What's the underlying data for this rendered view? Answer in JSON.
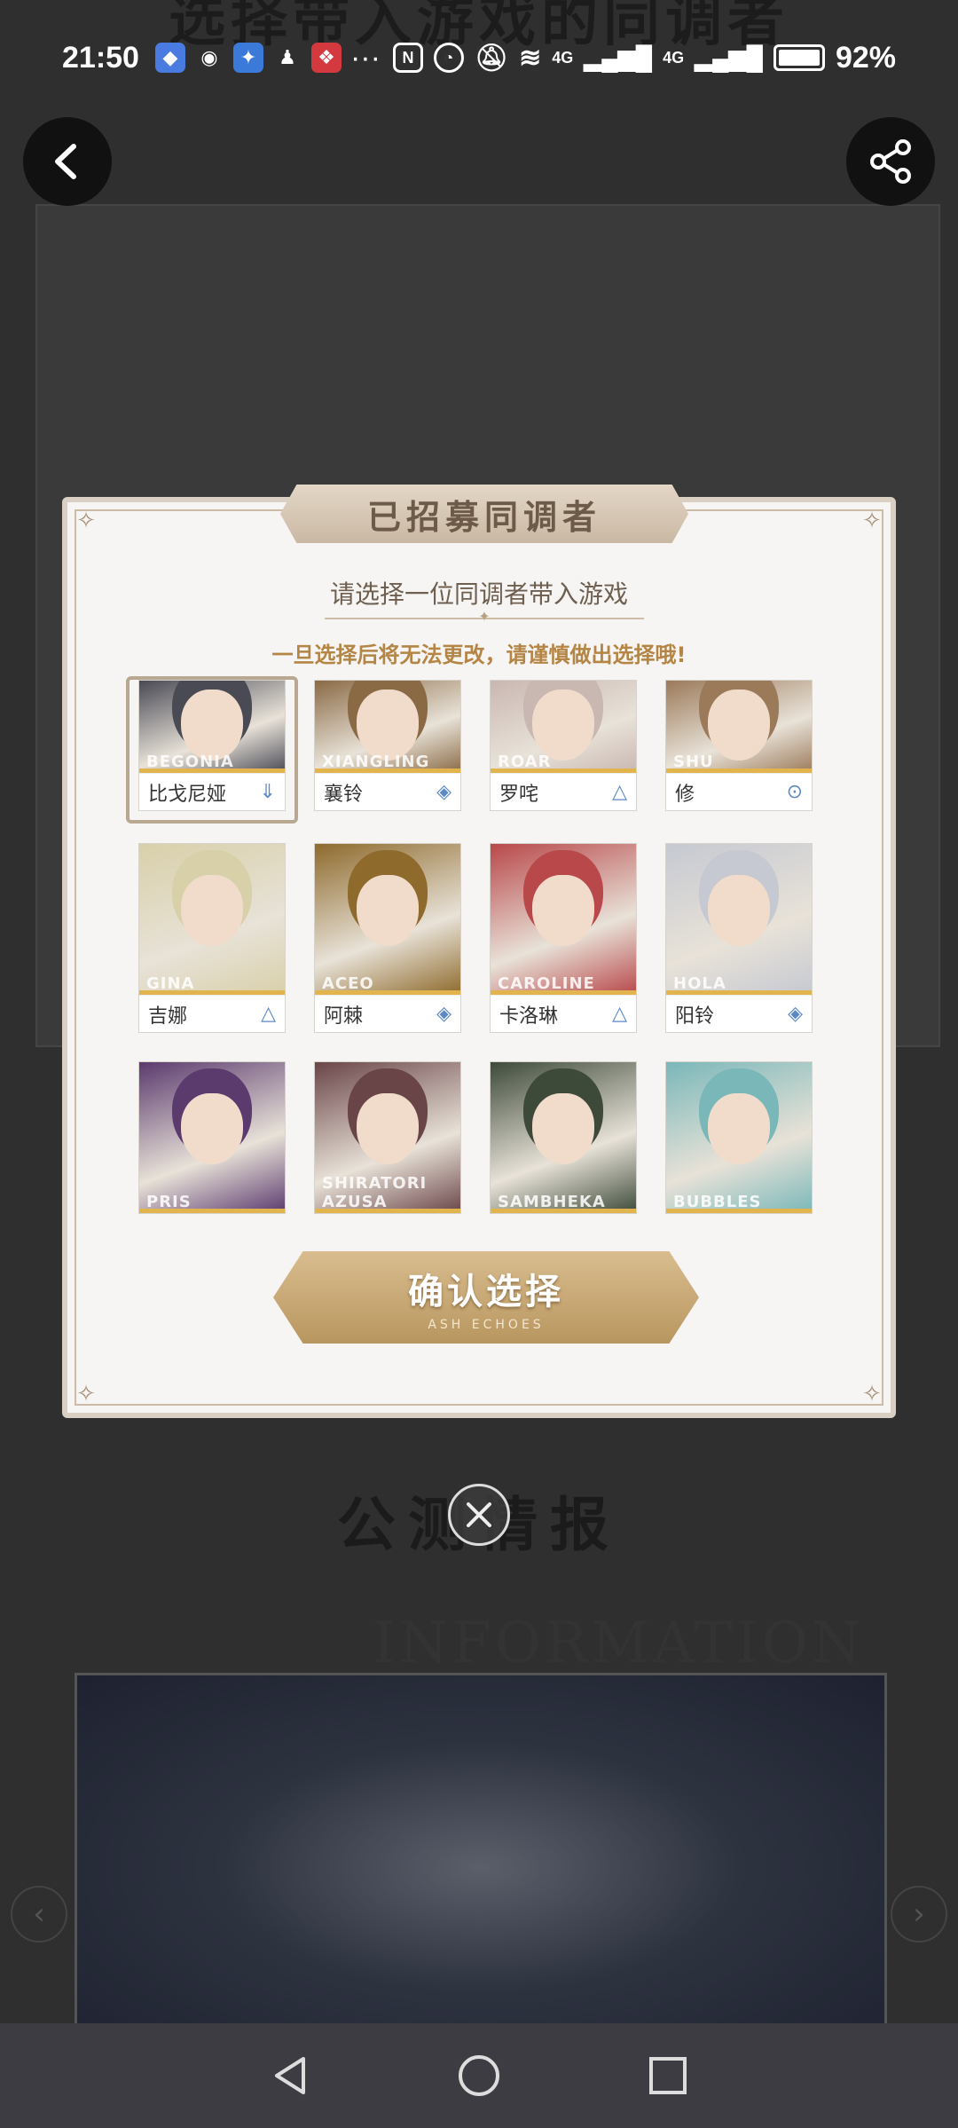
{
  "status_bar": {
    "time": "21:50",
    "more": "···",
    "battery": "92%",
    "network1": "4G",
    "network2": "4G"
  },
  "background": {
    "title": "选择带入游戏的同调者",
    "section_title": "公测情报",
    "info_word": "INFORMATION"
  },
  "dialog": {
    "banner": "已招募同调者",
    "subtitle": "请选择一位同调者带入游戏",
    "warning": "一旦选择后将无法更改，请谨慎做出选择哦!",
    "confirm_label": "确认选择",
    "confirm_sub": "ASH ECHOES"
  },
  "characters": [
    {
      "en": "BEGONIA",
      "name": "比戈尼娅",
      "type": "⇓",
      "color": "#4a4a55",
      "selected": true
    },
    {
      "en": "XIANGLING",
      "name": "襄铃",
      "type": "◈",
      "color": "#8a6a45"
    },
    {
      "en": "ROAR",
      "name": "罗咤",
      "type": "△",
      "color": "#c9b7b1"
    },
    {
      "en": "SHU",
      "name": "修",
      "type": "⊙",
      "color": "#9b7a5a"
    },
    {
      "en": "GINA",
      "name": "吉娜",
      "type": "△",
      "color": "#d8d0a9"
    },
    {
      "en": "ACEO",
      "name": "阿棘",
      "type": "◈",
      "color": "#8e6a2c"
    },
    {
      "en": "CAROLINE",
      "name": "卡洛琳",
      "type": "△",
      "color": "#b8484a"
    },
    {
      "en": "HOLA",
      "name": "阳铃",
      "type": "◈",
      "color": "#c6c9d2"
    },
    {
      "en": "PRIS",
      "name": "",
      "type": "",
      "color": "#5b3a6e"
    },
    {
      "en": "SHIRATORI AZUSA",
      "name": "",
      "type": "",
      "color": "#6a4548"
    },
    {
      "en": "SAMBHEKA",
      "name": "",
      "type": "",
      "color": "#3d4a3a"
    },
    {
      "en": "BUBBLES",
      "name": "",
      "type": "",
      "color": "#7ab7b9"
    }
  ]
}
